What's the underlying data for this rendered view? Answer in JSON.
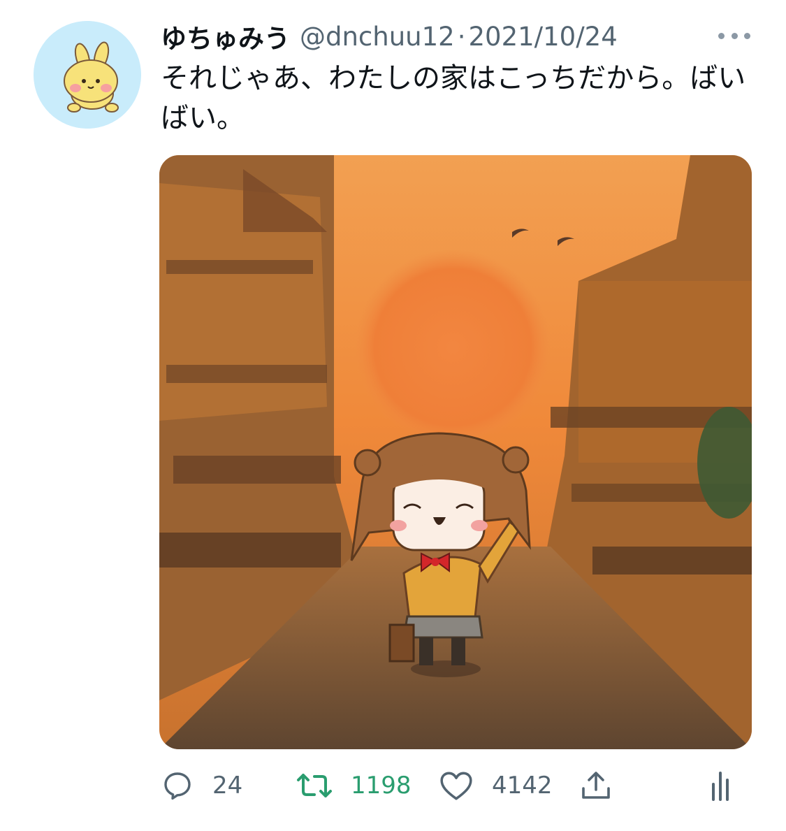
{
  "tweet": {
    "display_name": "ゆちゅみう",
    "handle": "@dnchuu12",
    "separator": "·",
    "date": "2021/10/24",
    "text": "それじゃあ、わたしの家はこっちだから。ばいばい。"
  },
  "actions": {
    "reply_count": "24",
    "retweet_count": "1198",
    "like_count": "4142"
  },
  "colors": {
    "secondary_text": "#536471",
    "retweet_active": "#2a9d6f",
    "avatar_bg": "#c9ecfb",
    "sunset_orange": "#f08a3c"
  },
  "icons": {
    "reply": "reply-icon",
    "retweet": "retweet-icon",
    "like": "heart-icon",
    "share": "share-icon",
    "analytics": "analytics-icon",
    "more": "more-icon"
  }
}
